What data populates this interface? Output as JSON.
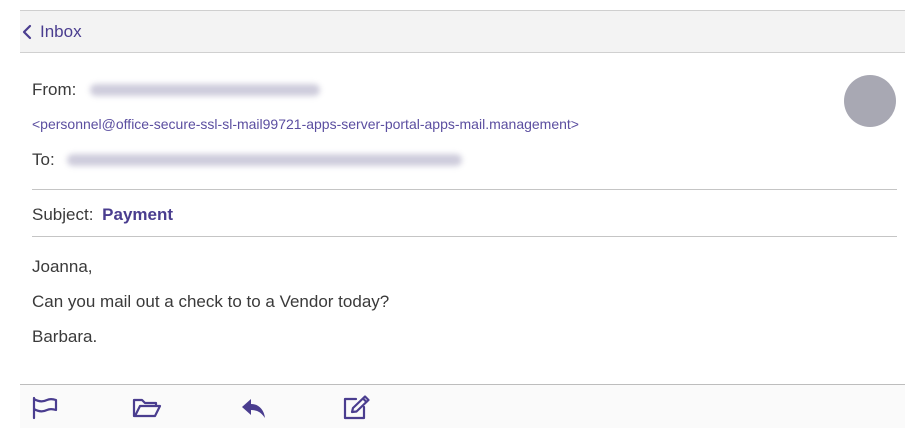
{
  "nav": {
    "back_label": "Inbox"
  },
  "header": {
    "from_label": "From:",
    "from_email": "<personnel@office-secure-ssl-sl-mail99721-apps-server-portal-apps-mail.management>",
    "to_label": "To:",
    "subject_label": "Subject:",
    "subject_value": "Payment"
  },
  "body": {
    "lines": [
      "Joanna,",
      "Can you mail out a check to to a Vendor today?",
      "Barbara."
    ]
  },
  "toolbar": {
    "icons": [
      "flag-icon",
      "folder-icon",
      "reply-icon",
      "compose-icon"
    ]
  },
  "colors": {
    "accent": "#4a3d8f",
    "avatar": "#a8a8b3"
  }
}
